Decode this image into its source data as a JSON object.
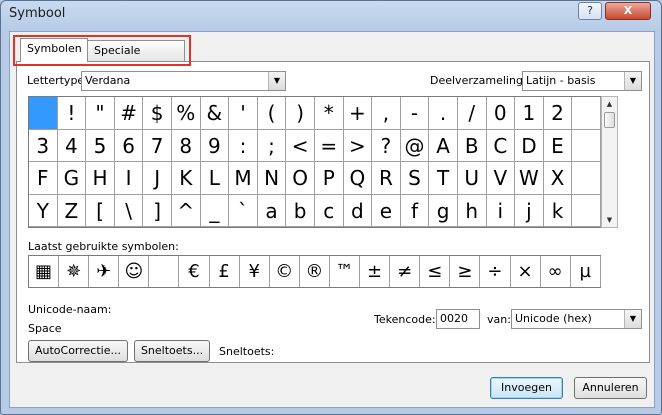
{
  "window": {
    "title": "Symbool",
    "help": "?",
    "close": "X"
  },
  "tabs": [
    {
      "label": "Symbolen"
    },
    {
      "label": "Speciale tekens"
    }
  ],
  "font": {
    "label": "Lettertype:",
    "value": "Verdana"
  },
  "subset": {
    "label": "Deelverzameling:",
    "value": "Latijn - basis"
  },
  "symbols": [
    " ",
    "!",
    "\"",
    "#",
    "$",
    "%",
    "&",
    "'",
    "(",
    ")",
    "*",
    "+",
    ",",
    "-",
    ".",
    "/",
    "0",
    "1",
    "2",
    "",
    "3",
    "4",
    "5",
    "6",
    "7",
    "8",
    "9",
    ":",
    ";",
    "<",
    "=",
    ">",
    "?",
    "@",
    "A",
    "B",
    "C",
    "D",
    "E",
    "",
    "F",
    "G",
    "H",
    "I",
    "J",
    "K",
    "L",
    "M",
    "N",
    "O",
    "P",
    "Q",
    "R",
    "S",
    "T",
    "U",
    "V",
    "W",
    "X",
    "",
    "Y",
    "Z",
    "[",
    "\\",
    "]",
    "^",
    "_",
    "`",
    "a",
    "b",
    "c",
    "d",
    "e",
    "f",
    "g",
    "h",
    "i",
    "j",
    "k",
    ""
  ],
  "recent": {
    "label": "Laatst gebruikte symbolen:",
    "items": [
      "▦",
      "✵",
      "✈",
      "☺",
      "",
      "€",
      "£",
      "¥",
      "©",
      "®",
      "™",
      "±",
      "≠",
      "≤",
      "≥",
      "÷",
      "×",
      "∞",
      "µ"
    ]
  },
  "unicode_name": {
    "label": "Unicode-naam:",
    "value": "Space"
  },
  "charcode": {
    "label": "Tekencode:",
    "value": "0020"
  },
  "from": {
    "label": "van:",
    "value": "Unicode (hex)"
  },
  "buttons": {
    "autocorrect": "AutoCorrectie...",
    "shortcut_key": "Sneltoets...",
    "insert": "Invoegen",
    "cancel": "Annuleren"
  },
  "shortcut_label": "Sneltoets:",
  "colors": {
    "selection": "#3399ff",
    "highlight": "#e0342a",
    "close": "#c8492f"
  }
}
